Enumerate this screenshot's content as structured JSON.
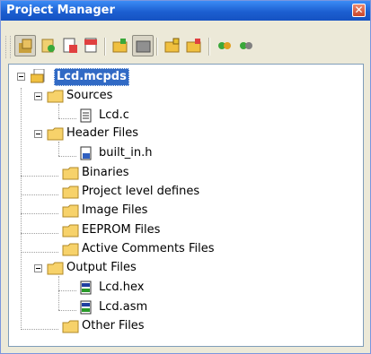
{
  "window": {
    "title": "Project Manager",
    "close_glyph": "✕"
  },
  "toolbar": {
    "buttons": [
      {
        "name": "open-project-icon",
        "pressed": true
      },
      {
        "name": "save-project-icon"
      },
      {
        "name": "add-file-icon"
      },
      {
        "name": "remove-file-icon"
      },
      {
        "name": "new-folder-icon"
      },
      {
        "name": "view-icon",
        "pressed": true
      },
      {
        "name": "add-folder-icon"
      },
      {
        "name": "delete-folder-icon"
      },
      {
        "name": "build-icon"
      },
      {
        "name": "build-all-icon"
      }
    ]
  },
  "tree": {
    "root": "Lcd.mcpds",
    "sources": {
      "label": "Sources",
      "children": [
        "Lcd.c"
      ]
    },
    "header_files": {
      "label": "Header Files",
      "children": [
        "built_in.h"
      ]
    },
    "binaries": "Binaries",
    "project_defines": "Project level defines",
    "image_files": "Image Files",
    "eeprom_files": "EEPROM Files",
    "active_comments": "Active Comments Files",
    "output_files": {
      "label": "Output Files",
      "children": [
        "Lcd.hex",
        "Lcd.asm"
      ]
    },
    "other_files": "Other Files"
  }
}
